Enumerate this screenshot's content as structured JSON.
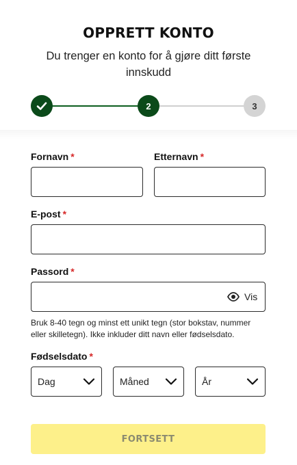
{
  "header": {
    "title": "OPPRETT KONTO",
    "subtitle": "Du trenger en konto for å gjøre ditt første innskudd"
  },
  "stepper": {
    "current_step": 2,
    "total_steps": 3,
    "steps": [
      {
        "label": "",
        "state": "completed",
        "icon": "checkmark-icon"
      },
      {
        "label": "2",
        "state": "active"
      },
      {
        "label": "3",
        "state": "upcoming"
      }
    ],
    "colors": {
      "done": "#0b4a1a",
      "upcoming": "#d4d4d4"
    }
  },
  "form": {
    "required_marker": "*",
    "first_name": {
      "label": "Fornavn",
      "value": "",
      "placeholder": ""
    },
    "last_name": {
      "label": "Etternavn",
      "value": "",
      "placeholder": ""
    },
    "email": {
      "label": "E-post",
      "value": "",
      "placeholder": ""
    },
    "password": {
      "label": "Passord",
      "value": "",
      "placeholder": "",
      "show_label": "Vis",
      "show_icon": "eye-icon",
      "help": "Bruk 8-40 tegn og minst ett unikt tegn (stor bokstav, nummer eller skilletegn). Ikke inkluder ditt navn eller fødselsdato."
    },
    "birthdate": {
      "label": "Fødselsdato",
      "day": {
        "value": "Dag",
        "icon": "chevron-down-icon"
      },
      "month": {
        "value": "Måned",
        "icon": "chevron-down-icon"
      },
      "year": {
        "value": "År",
        "icon": "chevron-down-icon"
      }
    },
    "submit_label": "FORTSETT"
  },
  "colors": {
    "required": "#d62828",
    "submit_bg": "#fdf08a",
    "submit_text": "#8a8a70",
    "border": "#2a2a2a"
  }
}
